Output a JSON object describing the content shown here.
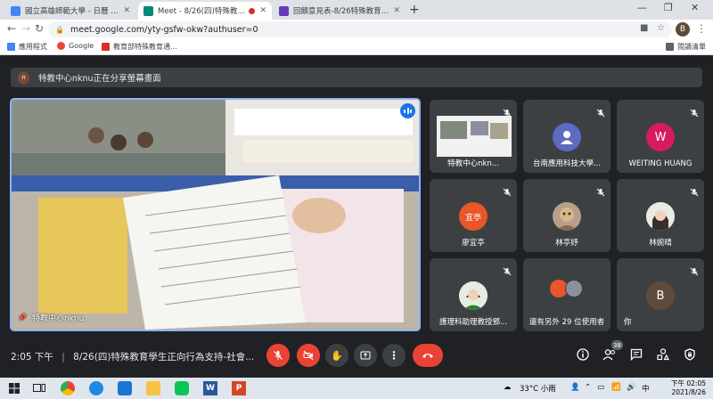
{
  "browser": {
    "tabs": [
      {
        "title": "國立高雄師範大學 - 日曆 - 2021...",
        "favicon_color": "#4285f4",
        "active": false
      },
      {
        "title": "Meet - 8/26(四)特殊教育學...",
        "favicon_color": "#00897b",
        "active": true,
        "recording": true
      },
      {
        "title": "回饋意見表-8/26特殊教育學生正...",
        "favicon_color": "#673ab7",
        "active": false
      }
    ],
    "new_tab_glyph": "+",
    "url": "meet.google.com/yty-gsfw-okw?authuser=0",
    "profile_initial": "B",
    "bookmarks": [
      {
        "label": "應用程式",
        "color": "#4285f4"
      },
      {
        "label": "Google",
        "color": "#ea4335"
      },
      {
        "label": "教育部特殊教育通...",
        "color": "#d93025"
      }
    ],
    "reading_list": "閱讀清單"
  },
  "meet": {
    "presenting_banner": {
      "initial": "n",
      "text": "特教中心nknu正在分享螢幕畫面"
    },
    "main_speaker": {
      "name": "特教中心nknu"
    },
    "participants": [
      {
        "name": "特教中心nkn...",
        "type": "screen",
        "muted": true
      },
      {
        "name": "台南應用科技大學...",
        "type": "avatar-icon",
        "avatar_color": "#5c6bc0",
        "muted": true
      },
      {
        "name": "WEITING HUANG",
        "type": "initial",
        "initial": "W",
        "avatar_color": "#d81b60",
        "muted": true
      },
      {
        "name": "廖宜亭",
        "type": "initial",
        "initial": "宜亭",
        "avatar_color": "#e8562a",
        "muted": true
      },
      {
        "name": "林亭妤",
        "type": "photo",
        "avatar_color": "#b8a088",
        "muted": true
      },
      {
        "name": "林婉晴",
        "type": "photo",
        "avatar_color": "#c9b7a6",
        "muted": true
      },
      {
        "name": "護理科助理教授鄧...",
        "type": "photo",
        "avatar_color": "#a5c4a0",
        "muted": true
      },
      {
        "name": "還有另外 29 位使用者",
        "type": "more",
        "muted": false
      },
      {
        "name": "你",
        "type": "initial",
        "initial": "B",
        "avatar_color": "#5f4b3a",
        "muted": true
      }
    ],
    "bottom_bar": {
      "time": "2:05 下午",
      "separator": "|",
      "meeting_title": "8/26(四)特殊教育學生正向行為支持-社會...",
      "participant_count": "38"
    }
  },
  "taskbar": {
    "temperature": "33°C 小雨",
    "ime": "中",
    "time": "下午 02:05",
    "date": "2021/8/26"
  },
  "colors": {
    "meet_bg": "#202124",
    "tile_bg": "#3c4043",
    "danger": "#ea4335",
    "active_speaker": "#8ab4f8"
  }
}
